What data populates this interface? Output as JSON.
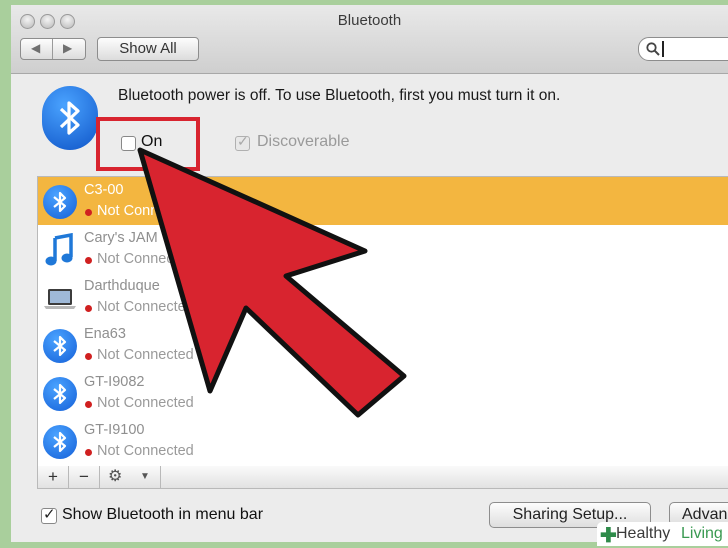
{
  "window": {
    "title": "Bluetooth"
  },
  "toolbar": {
    "back_icon": "back-arrow-icon",
    "forward_icon": "forward-arrow-icon",
    "show_all_label": "Show All",
    "search_placeholder": ""
  },
  "panel": {
    "message": "Bluetooth power is off. To use Bluetooth, first you must turn it on.",
    "on_label": "On",
    "on_checked": false,
    "discoverable_label": "Discoverable",
    "discoverable_checked": true
  },
  "devices": [
    {
      "name": "C3-00",
      "status": "Not Connected",
      "icon": "bluetooth-icon",
      "selected": true
    },
    {
      "name": "Cary's JAM",
      "status": "Not Connected",
      "icon": "music-note-icon",
      "selected": false
    },
    {
      "name": "Darthduque",
      "status": "Not Connected",
      "icon": "laptop-icon",
      "selected": false
    },
    {
      "name": "Ena63",
      "status": "Not Connected",
      "icon": "bluetooth-icon",
      "selected": false
    },
    {
      "name": "GT-I9082",
      "status": "Not Connected",
      "icon": "bluetooth-icon",
      "selected": false
    },
    {
      "name": "GT-I9100",
      "status": "Not Connected",
      "icon": "bluetooth-icon",
      "selected": false
    }
  ],
  "list_toolbar": {
    "add": "+",
    "remove": "−",
    "gear_icon": "gear-icon"
  },
  "footer": {
    "show_in_menubar_label": "Show Bluetooth in menu bar",
    "show_in_menubar_checked": true,
    "sharing_button": "Sharing Setup...",
    "advanced_button": "Advanced..."
  },
  "watermark": {
    "part1": "Healthy",
    "part2": "Living"
  },
  "colors": {
    "selection": "#f3b640",
    "highlight_box": "#d8242f",
    "arrow_fill": "#d8242f",
    "bluetooth_blue": "#1560d8"
  }
}
